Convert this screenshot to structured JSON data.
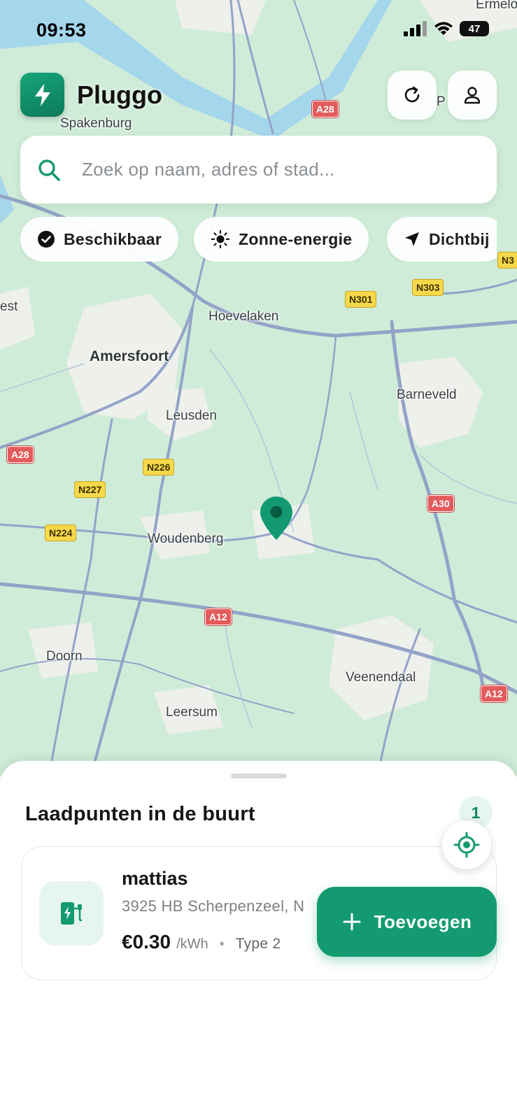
{
  "status_bar": {
    "time": "09:53",
    "battery": "47"
  },
  "header": {
    "app_name": "Pluggo"
  },
  "search": {
    "placeholder": "Zoek op naam, adres of stad..."
  },
  "filters": [
    {
      "label": "Beschikbaar",
      "icon": "check-circle-icon"
    },
    {
      "label": "Zonne-energie",
      "icon": "sun-icon"
    },
    {
      "label": "Dichtbij",
      "icon": "navigation-arrow-icon"
    }
  ],
  "map": {
    "places": {
      "ermelo": "Ermelo",
      "spakenburg": "Spakenburg",
      "putten": "P",
      "est": "est",
      "hoevelaken": "Hoevelaken",
      "amersfoort": "Amersfoort",
      "barneveld": "Barneveld",
      "leusden": "Leusden",
      "woudenberg": "Woudenberg",
      "doorn": "Doorn",
      "veenendaal": "Veenendaal",
      "leersum": "Leersum"
    },
    "roads": {
      "a28_top": "A28",
      "a28_left": "A28",
      "n301": "N301",
      "n303": "N303",
      "n3_edge": "N3",
      "n226": "N226",
      "n227": "N227",
      "n224": "N224",
      "a30": "A30",
      "a12_center": "A12",
      "a12_right": "A12"
    },
    "colors": {
      "land": "#cfecd8",
      "urban": "#f1f1ee",
      "water": "#9fd3ea",
      "road": "#8f9fc4",
      "pin": "#139a70"
    }
  },
  "sheet": {
    "title": "Laadpunten in de buurt",
    "count": "1",
    "station": {
      "name": "mattias",
      "address": "3925 HB Scherpenzeel, N",
      "price": "€0.30",
      "unit": "/kWh",
      "separator": "•",
      "plug": "Type 2"
    }
  },
  "fab": {
    "label": "Toevoegen"
  },
  "accent_color": "#139a70"
}
